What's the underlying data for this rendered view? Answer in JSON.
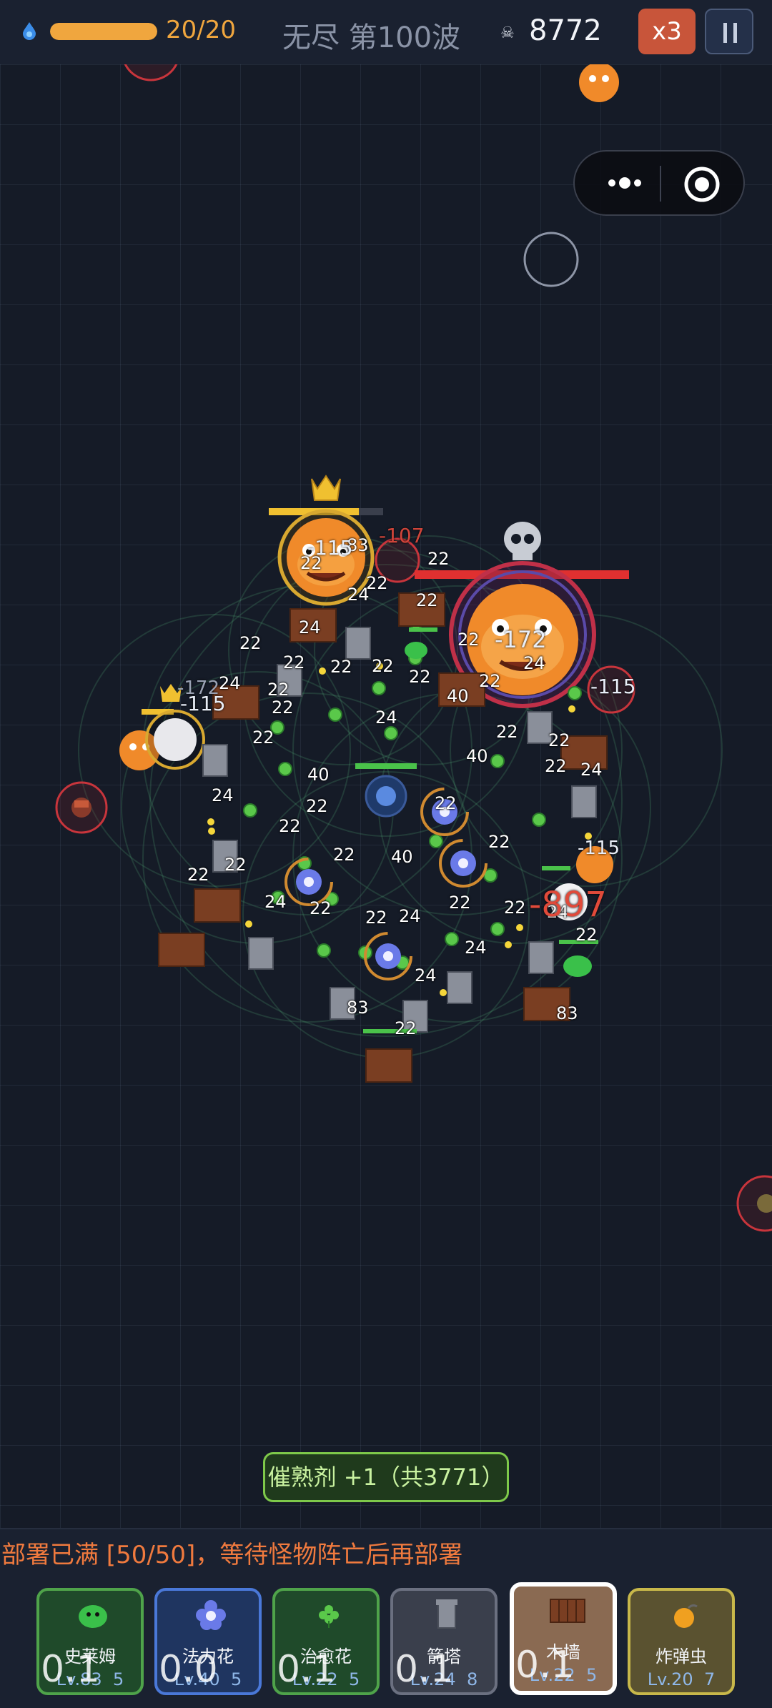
{
  "hud": {
    "hp_text": "20/20",
    "hp_fraction": 1.0,
    "wave_text": "无尽 第100波",
    "coins": "8772",
    "speed_label": "x3"
  },
  "floats": [
    {
      "text": "83"
    },
    {
      "text": "22"
    },
    {
      "text": "22"
    },
    {
      "text": "22"
    },
    {
      "text": "24"
    },
    {
      "text": "22"
    },
    {
      "text": "24"
    },
    {
      "text": "22"
    },
    {
      "text": "22"
    },
    {
      "text": "24"
    },
    {
      "text": "22"
    },
    {
      "text": "22"
    },
    {
      "text": "22"
    },
    {
      "text": "22"
    },
    {
      "text": "24"
    },
    {
      "text": "22"
    },
    {
      "text": "40"
    },
    {
      "text": "22"
    },
    {
      "text": "22"
    },
    {
      "text": "24"
    },
    {
      "text": "22"
    },
    {
      "text": "22"
    },
    {
      "text": "40"
    },
    {
      "text": "22"
    },
    {
      "text": "40"
    },
    {
      "text": "22"
    },
    {
      "text": "24"
    },
    {
      "text": "22"
    },
    {
      "text": "22"
    },
    {
      "text": "24"
    },
    {
      "text": "22"
    },
    {
      "text": "22"
    },
    {
      "text": "40"
    },
    {
      "text": "22"
    },
    {
      "text": "22"
    },
    {
      "text": "24"
    },
    {
      "text": "22"
    },
    {
      "text": "22"
    },
    {
      "text": "24"
    },
    {
      "text": "22"
    },
    {
      "text": "22"
    },
    {
      "text": "24"
    },
    {
      "text": "24"
    },
    {
      "text": "83"
    },
    {
      "text": "22"
    },
    {
      "text": "24"
    },
    {
      "text": "22"
    },
    {
      "text": "83"
    },
    {
      "text": "22"
    }
  ],
  "damage": [
    {
      "text": "-107"
    },
    {
      "text": "-172"
    },
    {
      "text": "-115"
    },
    {
      "text": "-172"
    },
    {
      "text": "-115"
    },
    {
      "text": "-115"
    },
    {
      "text": "-897"
    },
    {
      "text": "-115"
    }
  ],
  "toast": "催熟剂 +1（共3771）",
  "deploy_message": "部署已满 [50/50]，等待怪物阵亡后再部署",
  "cards": [
    {
      "name": "史莱姆",
      "level": "Lv.83",
      "count": "5",
      "cooldown": "0.1",
      "color": "#4fa34a",
      "bg": "#1f4a2a"
    },
    {
      "name": "法力花",
      "level": "Lv.40",
      "count": "5",
      "cooldown": "0.0",
      "color": "#4a78d8",
      "bg": "#1f3560"
    },
    {
      "name": "治愈花",
      "level": "Lv.22",
      "count": "5",
      "cooldown": "0.1",
      "color": "#4fa34a",
      "bg": "#1f4a2a"
    },
    {
      "name": "箭塔",
      "level": "Lv.24",
      "count": "8",
      "cooldown": "0.1",
      "color": "#6b7080",
      "bg": "#3a3f4c"
    },
    {
      "name": "木墙",
      "level": "Lv.22",
      "count": "5",
      "cooldown": "0.1",
      "color": "#ffffff",
      "bg": "#8a6a52"
    },
    {
      "name": "炸弹虫",
      "level": "Lv.20",
      "count": "7",
      "cooldown": "",
      "color": "#c8b84a",
      "bg": "#5a5230"
    }
  ]
}
